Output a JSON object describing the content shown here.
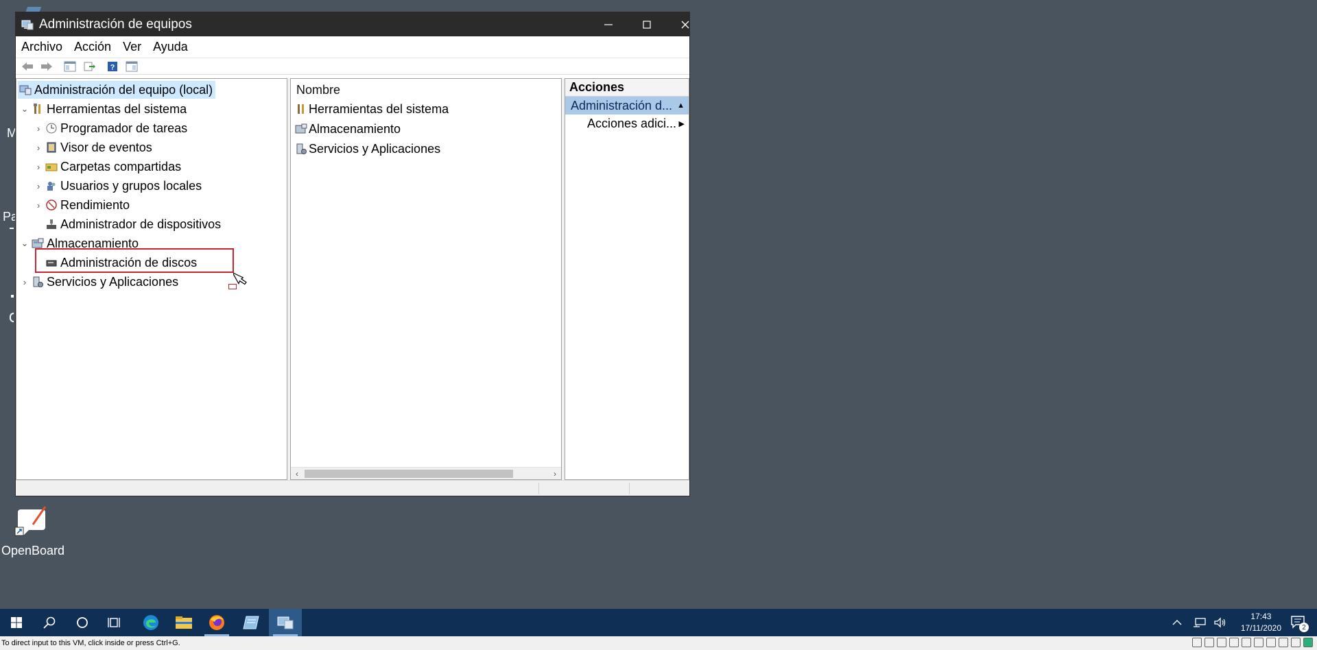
{
  "window": {
    "title": "Administración de equipos"
  },
  "menu": [
    "Archivo",
    "Acción",
    "Ver",
    "Ayuda"
  ],
  "tree": {
    "root": "Administración del equipo (local)",
    "system_tools": "Herramientas del sistema",
    "task_scheduler": "Programador de tareas",
    "event_viewer": "Visor de eventos",
    "shared_folders": "Carpetas compartidas",
    "local_users": "Usuarios y grupos locales",
    "performance": "Rendimiento",
    "device_manager": "Administrador de dispositivos",
    "storage": "Almacenamiento",
    "disk_management": "Administración de discos",
    "services_apps": "Servicios y Aplicaciones"
  },
  "list": {
    "header": "Nombre",
    "items": [
      "Herramientas del sistema",
      "Almacenamiento",
      "Servicios y Aplicaciones"
    ]
  },
  "actions": {
    "header": "Acciones",
    "group": "Administración d...",
    "item": "Acciones adici..."
  },
  "desktop": {
    "openboard_label": "OpenBoard",
    "frag_m": "M",
    "frag_pa": "Pa"
  },
  "clock": {
    "time": "17:43",
    "date": "17/11/2020"
  },
  "notifications": {
    "count": "2"
  },
  "vmbar": {
    "text": "To direct input to this VM, click inside or press Ctrl+G."
  },
  "colors": {
    "desktop_bg": "#4a545e",
    "taskbar_bg": "#0f2f55",
    "selection": "#cde8ff",
    "action_group": "#aac8e8",
    "highlight_box": "#c4262e"
  },
  "icons": {
    "start": "windows-start-icon",
    "search": "search-icon",
    "cortana": "cortana-circle-icon",
    "task_view": "task-view-icon",
    "edge": "edge-icon",
    "explorer": "file-explorer-icon",
    "firefox": "firefox-icon",
    "app": "app-icon",
    "computer_management": "computer-management-icon"
  }
}
